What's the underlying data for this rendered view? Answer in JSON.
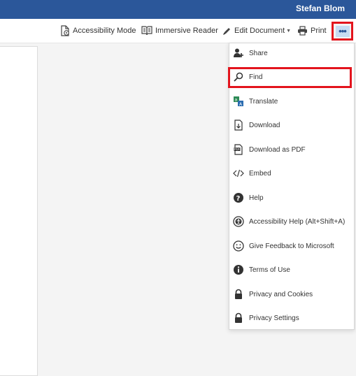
{
  "header": {
    "user_name": "Stefan Blom"
  },
  "toolbar": {
    "accessibility_mode": "Accessibility Mode",
    "immersive_reader": "Immersive Reader",
    "edit_document": "Edit Document",
    "print": "Print",
    "more_glyph": "•••"
  },
  "menu": {
    "items": [
      {
        "label": "Share",
        "icon": "share-person-icon"
      },
      {
        "label": "Find",
        "icon": "magnifier-icon"
      },
      {
        "label": "Translate",
        "icon": "translate-icon"
      },
      {
        "label": "Download",
        "icon": "download-icon"
      },
      {
        "label": "Download as PDF",
        "icon": "pdf-icon"
      },
      {
        "label": "Embed",
        "icon": "embed-icon"
      },
      {
        "label": "Help",
        "icon": "help-icon"
      },
      {
        "label": "Accessibility Help (Alt+Shift+A)",
        "icon": "accessibility-icon"
      },
      {
        "label": "Give Feedback to Microsoft",
        "icon": "smiley-icon"
      },
      {
        "label": "Terms of Use",
        "icon": "info-icon"
      },
      {
        "label": "Privacy and Cookies",
        "icon": "lock-icon"
      },
      {
        "label": "Privacy Settings",
        "icon": "lock-icon"
      }
    ]
  },
  "colors": {
    "brand": "#2b579a",
    "highlight": "#e3141d"
  }
}
